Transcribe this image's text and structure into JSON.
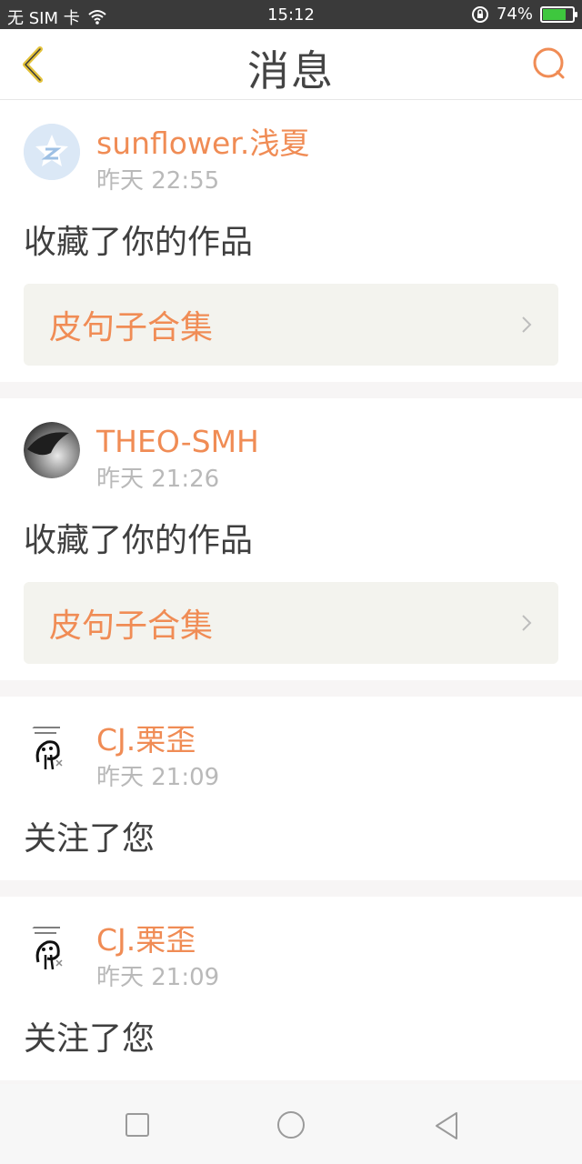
{
  "status_bar": {
    "carrier": "无 SIM 卡",
    "time": "15:12",
    "battery": "74%",
    "battery_level": 0.74
  },
  "navbar": {
    "title": "消息",
    "back_icon": "back-chevron-icon",
    "search_icon": "search-icon"
  },
  "colors": {
    "accent": "#f08c55",
    "back_icon": "#e3c23a",
    "time_text": "#b9b9b9"
  },
  "messages": [
    {
      "name": "sunflower.浅夏",
      "time": "昨天 22:55",
      "action": "收藏了你的作品",
      "work": "皮句子合集",
      "avatar": "default-avatar-icon"
    },
    {
      "name": "THEO-SMH",
      "time": "昨天 21:26",
      "action": "收藏了你的作品",
      "work": "皮句子合集",
      "avatar": "photo-avatar"
    },
    {
      "name": "CJ.栗歪",
      "time": "昨天 21:09",
      "action": "关注了您",
      "avatar": "cartoon-avatar"
    },
    {
      "name": "CJ.栗歪",
      "time": "昨天 21:09",
      "action": "关注了您",
      "avatar": "cartoon-avatar"
    }
  ],
  "system_nav": {
    "recent_icon": "square-icon",
    "home_icon": "circle-icon",
    "back_icon": "triangle-back-icon"
  }
}
